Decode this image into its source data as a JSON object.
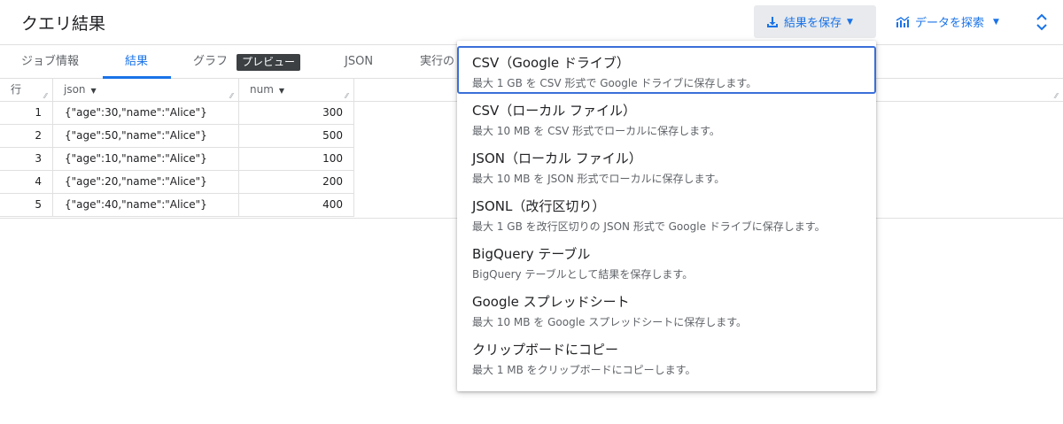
{
  "header": {
    "title": "クエリ結果",
    "save_button": "結果を保存",
    "explore_button": "データを探索"
  },
  "tabs": [
    {
      "label": "ジョブ情報",
      "active": false
    },
    {
      "label": "結果",
      "active": true
    },
    {
      "label": "グラフ",
      "active": false,
      "badge": "プレビュー"
    },
    {
      "label": "JSON",
      "active": false
    },
    {
      "label": "実行の",
      "active": false
    }
  ],
  "grid": {
    "columns": [
      "行",
      "json",
      "num"
    ],
    "rows": [
      {
        "row": "1",
        "json": "{\"age\":30,\"name\":\"Alice\"}",
        "num": "300"
      },
      {
        "row": "2",
        "json": "{\"age\":50,\"name\":\"Alice\"}",
        "num": "500"
      },
      {
        "row": "3",
        "json": "{\"age\":10,\"name\":\"Alice\"}",
        "num": "100"
      },
      {
        "row": "4",
        "json": "{\"age\":20,\"name\":\"Alice\"}",
        "num": "200"
      },
      {
        "row": "5",
        "json": "{\"age\":40,\"name\":\"Alice\"}",
        "num": "400"
      }
    ]
  },
  "save_menu": {
    "items": [
      {
        "title": "CSV（Google ドライブ）",
        "desc": "最大 1 GB を CSV 形式で Google ドライブに保存します。"
      },
      {
        "title": "CSV（ローカル ファイル）",
        "desc": "最大 10 MB を CSV 形式でローカルに保存します。"
      },
      {
        "title": "JSON（ローカル ファイル）",
        "desc": "最大 10 MB を JSON 形式でローカルに保存します。"
      },
      {
        "title": "JSONL（改行区切り）",
        "desc": "最大 1 GB を改行区切りの JSON 形式で Google ドライブに保存します。"
      },
      {
        "title": "BigQuery テーブル",
        "desc": "BigQuery テーブルとして結果を保存します。"
      },
      {
        "title": "Google スプレッドシート",
        "desc": "最大 10 MB を Google スプレッドシートに保存します。"
      },
      {
        "title": "クリップボードにコピー",
        "desc": "最大 1 MB をクリップボードにコピーします。"
      }
    ]
  },
  "icons": {
    "save": "download-icon",
    "explore": "chart-icon",
    "expand": "unfold-icon",
    "sort": "caret-down-icon"
  },
  "colors": {
    "accent": "#1a73e8",
    "focus_border": "#3b6fd8",
    "badge_bg": "#3c4043"
  }
}
